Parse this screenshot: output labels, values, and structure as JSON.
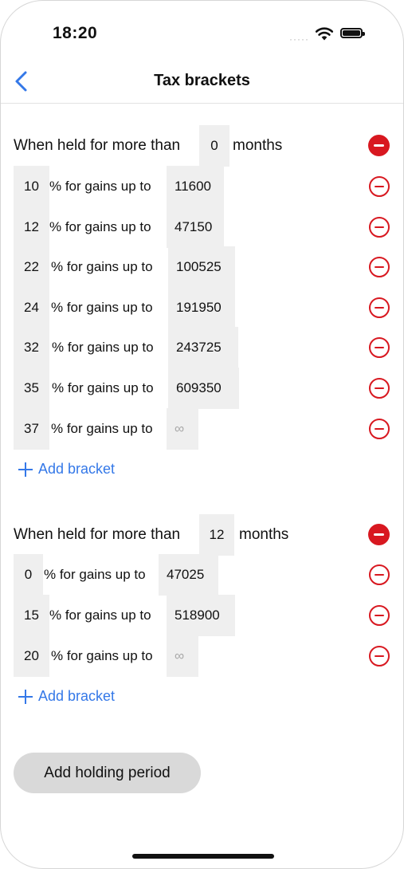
{
  "status": {
    "time": "18:20",
    "signal": "·····"
  },
  "nav": {
    "title": "Tax brackets"
  },
  "periods": [
    {
      "prefix": "When held for more than",
      "months": "0",
      "suffix": "months",
      "brackets": [
        {
          "rate": "10",
          "label": "% for gains up to",
          "upto": "11600"
        },
        {
          "rate": "12",
          "label": "% for gains up to",
          "upto": "47150"
        },
        {
          "rate": "22",
          "label": "% for gains up to",
          "upto": "100525"
        },
        {
          "rate": "24",
          "label": "% for gains up to",
          "upto": "191950"
        },
        {
          "rate": "32",
          "label": "% for gains up to",
          "upto": "243725"
        },
        {
          "rate": "35",
          "label": "% for gains up to",
          "upto": "609350"
        },
        {
          "rate": "37",
          "label": "% for gains up to",
          "upto": "∞"
        }
      ],
      "add_bracket": "Add bracket"
    },
    {
      "prefix": "When held for more than",
      "months": "12",
      "suffix": "months",
      "brackets": [
        {
          "rate": "0",
          "label": "% for gains up to",
          "upto": "47025"
        },
        {
          "rate": "15",
          "label": "% for gains up to",
          "upto": "518900"
        },
        {
          "rate": "20",
          "label": "% for gains up to",
          "upto": "∞"
        }
      ],
      "add_bracket": "Add bracket"
    }
  ],
  "add_period": "Add holding period",
  "colors": {
    "accent": "#3478e8",
    "destructive": "#d81820",
    "field": "#efefef",
    "button": "#d9d9d9"
  },
  "icons": {
    "back": "chevron-left-icon",
    "remove_period": "minus-circle-fill-icon",
    "remove_bracket": "minus-circle-icon",
    "add": "plus-icon"
  }
}
